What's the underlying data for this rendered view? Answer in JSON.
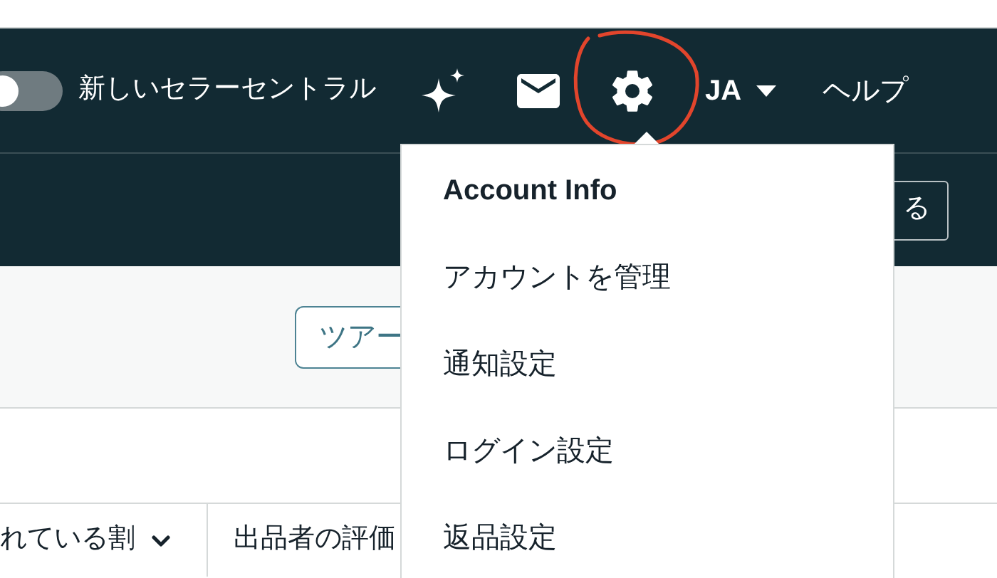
{
  "nav": {
    "toggle": {
      "on": false
    },
    "toggle_label": "新しいセラーセントラル",
    "account": "JA",
    "help": "ヘルプ"
  },
  "subbar": {
    "button": "る"
  },
  "tour_button": "ツアー",
  "table": {
    "columns": [
      {
        "label": "れている割",
        "sortable": true
      },
      {
        "label": "出品者の評価",
        "sortable": false
      }
    ]
  },
  "settings_menu": {
    "items": [
      {
        "label": "Account Info",
        "kind": "header"
      },
      {
        "label": "アカウントを管理",
        "kind": "link"
      },
      {
        "label": "通知設定",
        "kind": "link"
      },
      {
        "label": "ログイン設定",
        "kind": "link"
      },
      {
        "label": "返品設定",
        "kind": "link"
      }
    ]
  }
}
